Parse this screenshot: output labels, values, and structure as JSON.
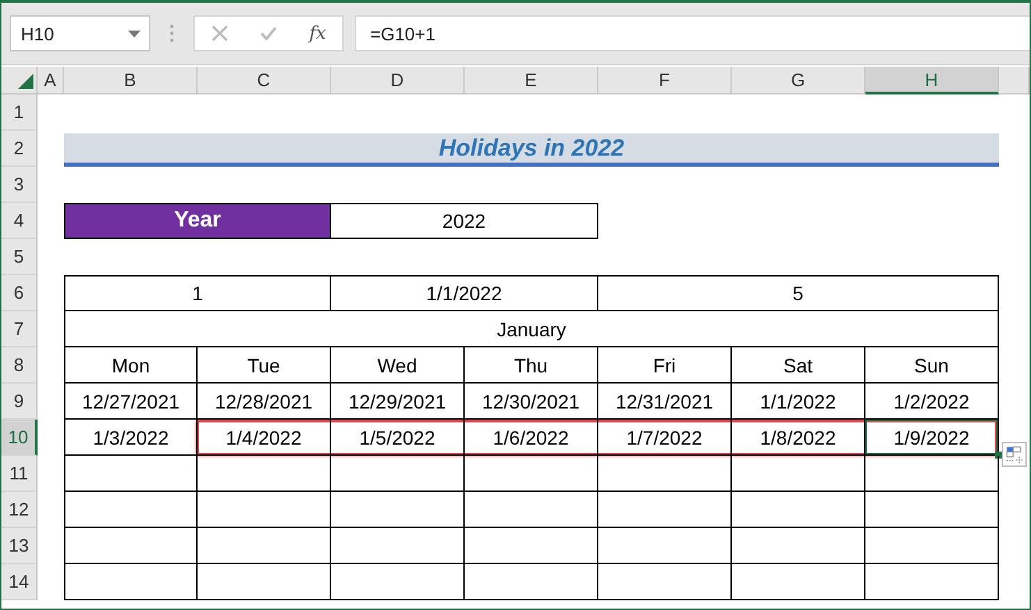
{
  "name_box": {
    "value": "H10"
  },
  "formula_bar": {
    "fx": "fx",
    "value": "=G10+1"
  },
  "columns": [
    {
      "label": "A",
      "selected": false
    },
    {
      "label": "B",
      "selected": false
    },
    {
      "label": "C",
      "selected": false
    },
    {
      "label": "D",
      "selected": false
    },
    {
      "label": "E",
      "selected": false
    },
    {
      "label": "F",
      "selected": false
    },
    {
      "label": "G",
      "selected": false
    },
    {
      "label": "H",
      "selected": true
    }
  ],
  "rows": [
    {
      "label": "1",
      "selected": false
    },
    {
      "label": "2",
      "selected": false
    },
    {
      "label": "3",
      "selected": false
    },
    {
      "label": "4",
      "selected": false
    },
    {
      "label": "5",
      "selected": false
    },
    {
      "label": "6",
      "selected": false
    },
    {
      "label": "7",
      "selected": false
    },
    {
      "label": "8",
      "selected": false
    },
    {
      "label": "9",
      "selected": false
    },
    {
      "label": "10",
      "selected": true
    },
    {
      "label": "11",
      "selected": false
    },
    {
      "label": "12",
      "selected": false
    },
    {
      "label": "13",
      "selected": false
    },
    {
      "label": "14",
      "selected": false
    }
  ],
  "title": "Holidays in 2022",
  "year": {
    "label": "Year",
    "value": "2022"
  },
  "info": [
    "1",
    "1/1/2022",
    "5"
  ],
  "month": "January",
  "weekdays": [
    "Mon",
    "Tue",
    "Wed",
    "Thu",
    "Fri",
    "Sat",
    "Sun"
  ],
  "weeks": [
    [
      {
        "text": "12/27/2021",
        "highlighted": false
      },
      {
        "text": "12/28/2021",
        "highlighted": false
      },
      {
        "text": "12/29/2021",
        "highlighted": false
      },
      {
        "text": "12/30/2021",
        "highlighted": false
      },
      {
        "text": "12/31/2021",
        "highlighted": false
      },
      {
        "text": "1/1/2022",
        "highlighted": false
      },
      {
        "text": "1/2/2022",
        "highlighted": false
      }
    ],
    [
      {
        "text": "1/3/2022",
        "highlighted": false
      },
      {
        "text": "1/4/2022",
        "highlighted": true
      },
      {
        "text": "1/5/2022",
        "highlighted": true
      },
      {
        "text": "1/6/2022",
        "highlighted": true
      },
      {
        "text": "1/7/2022",
        "highlighted": true
      },
      {
        "text": "1/8/2022",
        "highlighted": true
      },
      {
        "text": "1/9/2022",
        "highlighted": true
      }
    ]
  ]
}
